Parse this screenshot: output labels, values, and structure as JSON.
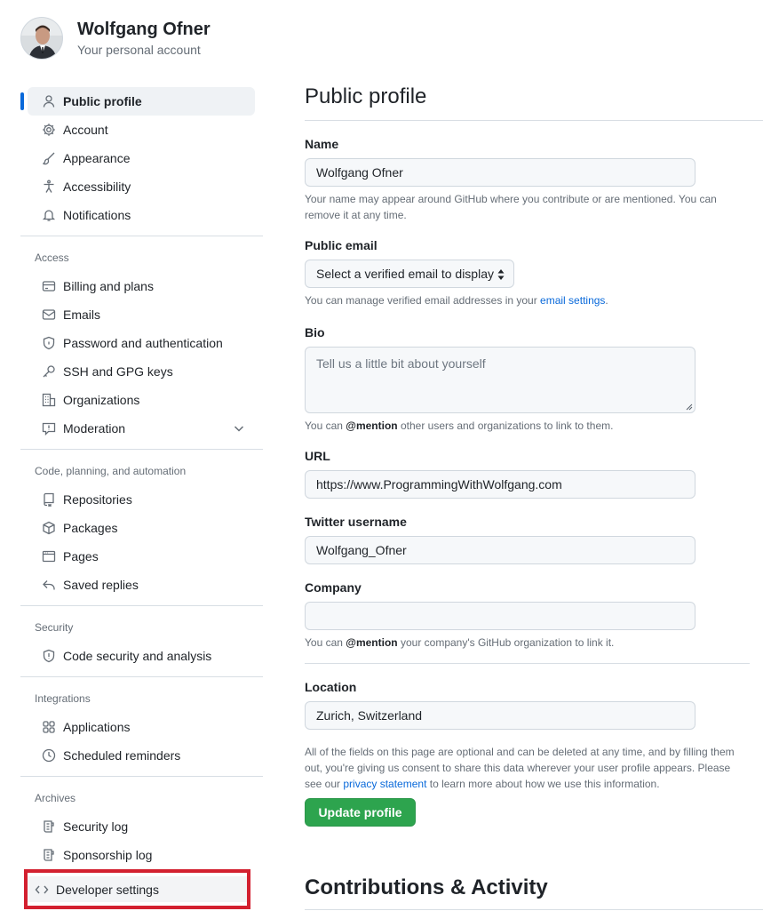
{
  "header": {
    "user_name": "Wolfgang Ofner",
    "user_subtitle": "Your personal account"
  },
  "sidebar": {
    "primary": [
      {
        "label": "Public profile",
        "icon": "person-icon",
        "active": true
      },
      {
        "label": "Account",
        "icon": "gear-icon"
      },
      {
        "label": "Appearance",
        "icon": "paintbrush-icon"
      },
      {
        "label": "Accessibility",
        "icon": "accessibility-icon"
      },
      {
        "label": "Notifications",
        "icon": "bell-icon"
      }
    ],
    "access_heading": "Access",
    "access": [
      {
        "label": "Billing and plans",
        "icon": "credit-card-icon"
      },
      {
        "label": "Emails",
        "icon": "mail-icon"
      },
      {
        "label": "Password and authentication",
        "icon": "shield-lock-icon"
      },
      {
        "label": "SSH and GPG keys",
        "icon": "key-icon"
      },
      {
        "label": "Organizations",
        "icon": "organization-icon"
      },
      {
        "label": "Moderation",
        "icon": "report-icon"
      }
    ],
    "code_heading": "Code, planning, and automation",
    "code": [
      {
        "label": "Repositories",
        "icon": "repo-icon"
      },
      {
        "label": "Packages",
        "icon": "package-icon"
      },
      {
        "label": "Pages",
        "icon": "browser-icon"
      },
      {
        "label": "Saved replies",
        "icon": "reply-icon"
      }
    ],
    "security_heading": "Security",
    "security": [
      {
        "label": "Code security and analysis",
        "icon": "shield-icon"
      }
    ],
    "integrations_heading": "Integrations",
    "integrations": [
      {
        "label": "Applications",
        "icon": "apps-icon"
      },
      {
        "label": "Scheduled reminders",
        "icon": "clock-icon"
      }
    ],
    "archives_heading": "Archives",
    "archives": [
      {
        "label": "Security log",
        "icon": "log-icon"
      },
      {
        "label": "Sponsorship log",
        "icon": "log-icon"
      }
    ],
    "developer_settings": "Developer settings"
  },
  "main": {
    "title": "Public profile",
    "name_label": "Name",
    "name_value": "Wolfgang Ofner",
    "name_note": "Your name may appear around GitHub where you contribute or are mentioned. You can remove it at any time.",
    "email_label": "Public email",
    "email_select": "Select a verified email to display",
    "email_note_pre": "You can manage verified email addresses in your ",
    "email_note_link": "email settings",
    "email_note_post": ".",
    "bio_label": "Bio",
    "bio_placeholder": "Tell us a little bit about yourself",
    "bio_note_pre": "You can ",
    "bio_note_mention": "@mention",
    "bio_note_post": " other users and organizations to link to them.",
    "url_label": "URL",
    "url_value": "https://www.ProgrammingWithWolfgang.com",
    "twitter_label": "Twitter username",
    "twitter_value": "Wolfgang_Ofner",
    "company_label": "Company",
    "company_value": "",
    "company_note_pre": "You can ",
    "company_note_mention": "@mention",
    "company_note_post": " your company's GitHub organization to link it.",
    "location_label": "Location",
    "location_value": "Zurich, Switzerland",
    "footer_note_pre": "All of the fields on this page are optional and can be deleted at any time, and by filling them out, you're giving us consent to share this data wherever your user profile appears. Please see our ",
    "footer_note_link": "privacy statement",
    "footer_note_post": " to learn more about how we use this information.",
    "update_button": "Update profile",
    "contributions_title": "Contributions & Activity"
  },
  "colors": {
    "accent": "#0969da",
    "primary_button": "#2da44e",
    "highlight_box": "#d3202f"
  }
}
